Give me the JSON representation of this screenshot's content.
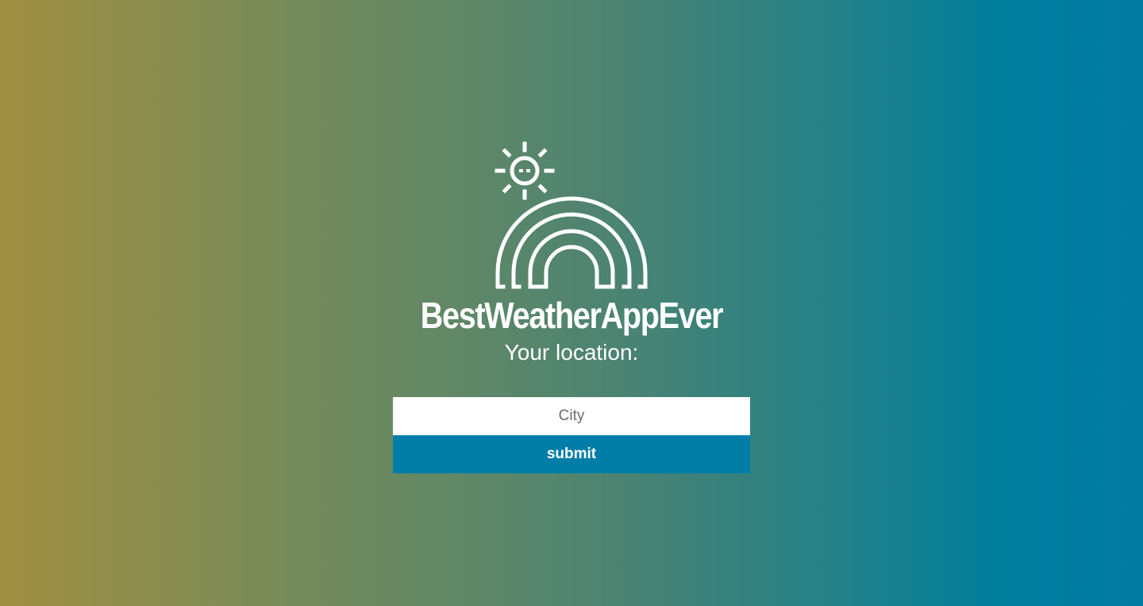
{
  "app": {
    "title": "BestWeatherAppEver",
    "logo_icon": "sun-rainbow-icon"
  },
  "form": {
    "location_label": "Your location:",
    "city_placeholder": "City",
    "city_value": "",
    "submit_label": "submit"
  },
  "colors": {
    "gradient_left": "#a08f40",
    "gradient_right": "#027ba3",
    "button_bg": "#007ea7",
    "text": "#ffffff",
    "input_bg": "#ffffff"
  }
}
